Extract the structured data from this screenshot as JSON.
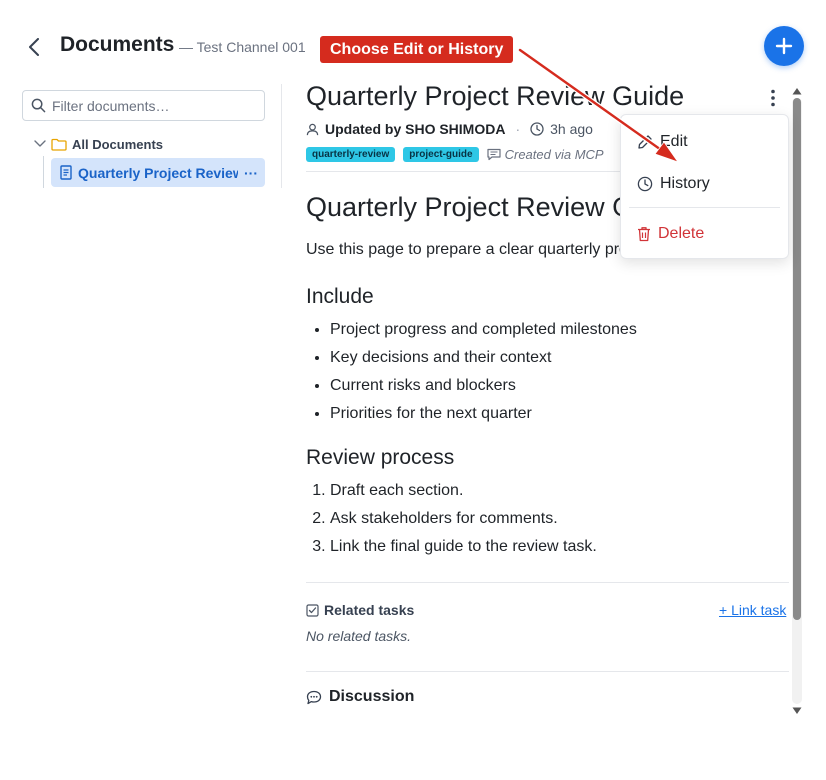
{
  "header": {
    "title": "Documents",
    "channel": "— Test Channel 001"
  },
  "annotation": {
    "callout": "Choose Edit or History"
  },
  "sidebar": {
    "filter_placeholder": "Filter documents…",
    "root_label": "All Documents",
    "selected_item": "Quarterly Project Review Guide",
    "selected_item_ellipsis": "···"
  },
  "document": {
    "title": "Quarterly Project Review Guide",
    "author": "Updated by SHO SHIMODA",
    "updated": "3h ago",
    "tags": [
      "quarterly-review",
      "project-guide"
    ],
    "created_via": "Created via MCP",
    "heading": "Quarterly Project Review Guide",
    "intro": "Use this page to prepare a clear quarterly project review.",
    "include_heading": "Include",
    "include_items": [
      "Project progress and completed milestones",
      "Key decisions and their context",
      "Current risks and blockers",
      "Priorities for the next quarter"
    ],
    "process_heading": "Review process",
    "process_items": [
      "Draft each section.",
      "Ask stakeholders for comments.",
      "Link the final guide to the review task."
    ]
  },
  "related": {
    "title": "Related tasks",
    "link_label": "+ Link task",
    "empty": "No related tasks."
  },
  "discussion": {
    "title": "Discussion"
  },
  "menu": {
    "edit": "Edit",
    "history": "History",
    "delete": "Delete"
  },
  "colors": {
    "accent": "#1a73e8",
    "callout": "#d52b1e",
    "tag": "#2ec7e6",
    "delete": "#d13438"
  }
}
